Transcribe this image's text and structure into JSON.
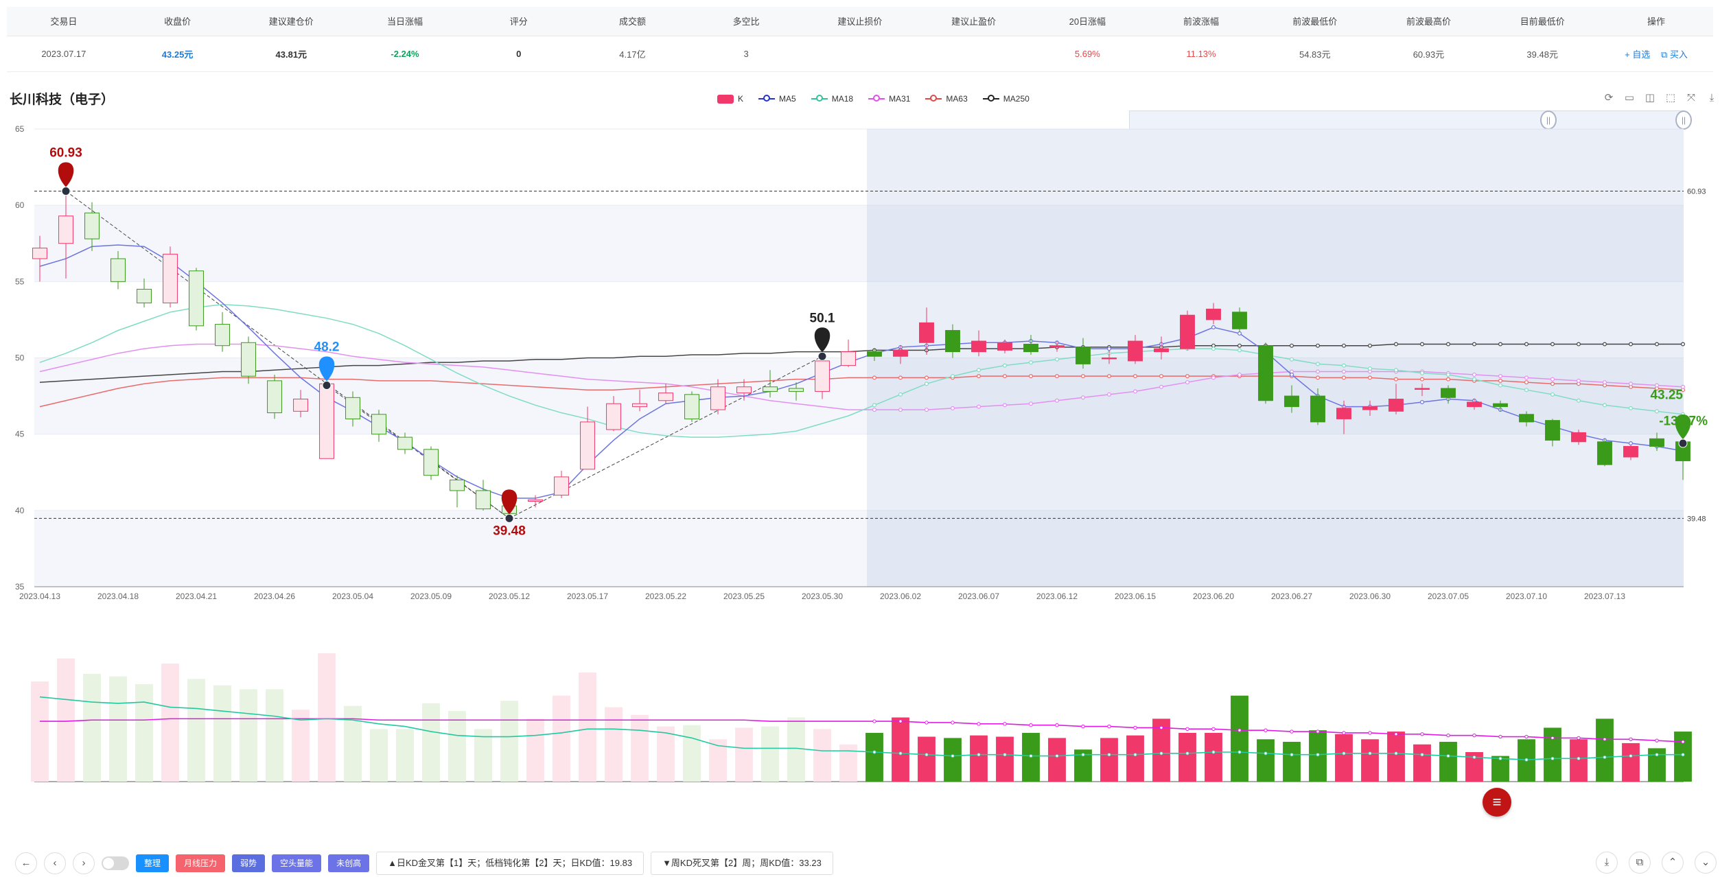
{
  "summary": {
    "headers": [
      "交易日",
      "收盘价",
      "建议建仓价",
      "当日涨幅",
      "评分",
      "成交额",
      "多空比",
      "建议止损价",
      "建议止盈价",
      "20日涨幅",
      "前波涨幅",
      "前波最低价",
      "前波最高价",
      "目前最低价",
      "操作"
    ],
    "row": {
      "date": "2023.07.17",
      "close": "43.25元",
      "build_price": "43.81元",
      "change": "-2.24%",
      "score": "0",
      "turnover": "4.17亿",
      "long_short": "3",
      "stop_loss": "",
      "take_profit": "",
      "change20": "5.69%",
      "prev_wave_change": "11.13%",
      "prev_wave_low": "54.83元",
      "prev_wave_high": "60.93元",
      "current_low": "39.48元",
      "op_watch": "+ 自选",
      "op_buy": "买入"
    }
  },
  "stock_title": "长川科技（电子）",
  "legend": [
    {
      "name": "K",
      "color": "#f0386a",
      "type": "k"
    },
    {
      "name": "MA5",
      "color": "#2233cc",
      "type": "line"
    },
    {
      "name": "MA18",
      "color": "#31c29a",
      "type": "line"
    },
    {
      "name": "MA31",
      "color": "#e34de8",
      "type": "line"
    },
    {
      "name": "MA63",
      "color": "#e04848",
      "type": "line"
    },
    {
      "name": "MA250",
      "color": "#222222",
      "type": "line"
    }
  ],
  "toolbox_icons": [
    "refresh-icon",
    "data-view-icon",
    "restore-icon",
    "brush-icon",
    "fullscreen-icon",
    "download-icon"
  ],
  "zoom": {
    "start_icon": "||",
    "end_icon": "||"
  },
  "colors": {
    "up": "#f0386a",
    "down": "#3a9a1a",
    "ma5": "#6b74e0",
    "ma18": "#7fdcc3",
    "ma31": "#e28ff0",
    "ma63": "#e86a6a",
    "ma250": "#444444",
    "vol_ma_green": "#20c9a0",
    "vol_ma_magenta": "#e11be5"
  },
  "chart_data": {
    "type": "candlestick",
    "title": "长川科技（电子）",
    "y_ticks": [
      35,
      40,
      45,
      50,
      55,
      60,
      65
    ],
    "ylim": [
      35,
      65
    ],
    "x_tick_labels": [
      "2023.04.13",
      "2023.04.18",
      "2023.04.21",
      "2023.04.26",
      "2023.05.04",
      "2023.05.09",
      "2023.05.12",
      "2023.05.17",
      "2023.05.22",
      "2023.05.25",
      "2023.05.30",
      "2023.06.02",
      "2023.06.07",
      "2023.06.12",
      "2023.06.15",
      "2023.06.20",
      "2023.06.27",
      "2023.06.30",
      "2023.07.05",
      "2023.07.10",
      "2023.07.13"
    ],
    "x_tick_index": [
      0,
      3,
      6,
      9,
      12,
      15,
      18,
      21,
      24,
      27,
      30,
      33,
      36,
      39,
      42,
      45,
      48,
      51,
      54,
      57,
      60
    ],
    "candles": [
      {
        "o": 56.5,
        "c": 57.2,
        "h": 58.0,
        "l": 55.0
      },
      {
        "o": 57.5,
        "c": 59.3,
        "h": 60.93,
        "l": 55.2
      },
      {
        "o": 59.5,
        "c": 57.8,
        "h": 60.2,
        "l": 57.0
      },
      {
        "o": 56.5,
        "c": 55.0,
        "h": 57.0,
        "l": 54.5
      },
      {
        "o": 54.5,
        "c": 53.6,
        "h": 55.2,
        "l": 53.3
      },
      {
        "o": 53.6,
        "c": 56.8,
        "h": 57.3,
        "l": 53.3
      },
      {
        "o": 55.7,
        "c": 52.1,
        "h": 55.9,
        "l": 51.8
      },
      {
        "o": 52.2,
        "c": 50.8,
        "h": 53.0,
        "l": 50.4
      },
      {
        "o": 51.0,
        "c": 48.8,
        "h": 51.4,
        "l": 48.3
      },
      {
        "o": 48.5,
        "c": 46.4,
        "h": 48.9,
        "l": 46.0
      },
      {
        "o": 46.5,
        "c": 47.3,
        "h": 47.9,
        "l": 46.1
      },
      {
        "o": 43.4,
        "c": 48.3,
        "h": 49.0,
        "l": 43.4
      },
      {
        "o": 47.4,
        "c": 46.0,
        "h": 47.8,
        "l": 45.5
      },
      {
        "o": 46.3,
        "c": 45.0,
        "h": 46.6,
        "l": 44.5
      },
      {
        "o": 44.8,
        "c": 44.0,
        "h": 45.1,
        "l": 43.7
      },
      {
        "o": 44.0,
        "c": 42.3,
        "h": 44.2,
        "l": 42.0
      },
      {
        "o": 42.0,
        "c": 41.3,
        "h": 42.3,
        "l": 40.2
      },
      {
        "o": 41.3,
        "c": 40.1,
        "h": 42.0,
        "l": 40.0
      },
      {
        "o": 40.3,
        "c": 39.8,
        "h": 40.6,
        "l": 39.48
      },
      {
        "o": 40.6,
        "c": 40.7,
        "h": 41.0,
        "l": 40.2
      },
      {
        "o": 41.0,
        "c": 42.2,
        "h": 42.6,
        "l": 40.8
      },
      {
        "o": 42.7,
        "c": 45.8,
        "h": 46.8,
        "l": 42.7
      },
      {
        "o": 45.3,
        "c": 47.0,
        "h": 47.5,
        "l": 45.2
      },
      {
        "o": 46.8,
        "c": 47.0,
        "h": 47.9,
        "l": 46.5
      },
      {
        "o": 47.2,
        "c": 47.7,
        "h": 48.3,
        "l": 47.0
      },
      {
        "o": 47.6,
        "c": 46.0,
        "h": 47.8,
        "l": 45.8
      },
      {
        "o": 46.6,
        "c": 48.1,
        "h": 48.6,
        "l": 46.3
      },
      {
        "o": 47.7,
        "c": 48.1,
        "h": 48.6,
        "l": 47.2
      },
      {
        "o": 48.1,
        "c": 47.8,
        "h": 49.2,
        "l": 47.4
      },
      {
        "o": 48.0,
        "c": 47.8,
        "h": 48.4,
        "l": 47.2
      },
      {
        "o": 47.8,
        "c": 49.8,
        "h": 50.4,
        "l": 47.3
      },
      {
        "o": 49.5,
        "c": 50.4,
        "h": 51.2,
        "l": 49.4
      },
      {
        "o": 50.4,
        "c": 50.1,
        "h": 50.6,
        "l": 49.8
      },
      {
        "o": 50.1,
        "c": 50.5,
        "h": 50.8,
        "l": 49.6
      },
      {
        "o": 51.0,
        "c": 52.3,
        "h": 53.3,
        "l": 50.2
      },
      {
        "o": 51.8,
        "c": 50.4,
        "h": 52.2,
        "l": 50.0
      },
      {
        "o": 50.4,
        "c": 51.1,
        "h": 51.8,
        "l": 50.1
      },
      {
        "o": 50.5,
        "c": 51.0,
        "h": 51.2,
        "l": 50.3
      },
      {
        "o": 50.9,
        "c": 50.4,
        "h": 51.5,
        "l": 50.2
      },
      {
        "o": 50.7,
        "c": 50.8,
        "h": 51.1,
        "l": 50.4
      },
      {
        "o": 50.7,
        "c": 49.6,
        "h": 51.3,
        "l": 49.3
      },
      {
        "o": 50.0,
        "c": 50.0,
        "h": 50.5,
        "l": 49.6
      },
      {
        "o": 49.8,
        "c": 51.1,
        "h": 51.5,
        "l": 49.6
      },
      {
        "o": 50.4,
        "c": 50.6,
        "h": 51.4,
        "l": 49.9
      },
      {
        "o": 50.6,
        "c": 52.8,
        "h": 53.1,
        "l": 50.5
      },
      {
        "o": 52.5,
        "c": 53.2,
        "h": 53.6,
        "l": 52.2
      },
      {
        "o": 53.0,
        "c": 51.9,
        "h": 53.3,
        "l": 51.7
      },
      {
        "o": 50.8,
        "c": 47.2,
        "h": 51.0,
        "l": 47.0
      },
      {
        "o": 47.5,
        "c": 46.8,
        "h": 48.2,
        "l": 46.4
      },
      {
        "o": 47.5,
        "c": 45.8,
        "h": 48.0,
        "l": 45.6
      },
      {
        "o": 46.0,
        "c": 46.7,
        "h": 47.2,
        "l": 45.0
      },
      {
        "o": 46.6,
        "c": 46.8,
        "h": 47.2,
        "l": 46.2
      },
      {
        "o": 46.5,
        "c": 47.3,
        "h": 48.3,
        "l": 46.3
      },
      {
        "o": 48.0,
        "c": 48.0,
        "h": 48.3,
        "l": 47.5
      },
      {
        "o": 48.0,
        "c": 47.4,
        "h": 48.2,
        "l": 47.0
      },
      {
        "o": 46.8,
        "c": 47.1,
        "h": 47.3,
        "l": 46.6
      },
      {
        "o": 47.0,
        "c": 46.8,
        "h": 47.2,
        "l": 46.5
      },
      {
        "o": 46.3,
        "c": 45.8,
        "h": 46.5,
        "l": 45.5
      },
      {
        "o": 45.9,
        "c": 44.6,
        "h": 46.0,
        "l": 44.2
      },
      {
        "o": 44.5,
        "c": 45.1,
        "h": 45.3,
        "l": 44.3
      },
      {
        "o": 44.5,
        "c": 43.0,
        "h": 44.7,
        "l": 42.9
      },
      {
        "o": 43.5,
        "c": 44.2,
        "h": 44.3,
        "l": 43.3
      },
      {
        "o": 44.7,
        "c": 44.2,
        "h": 45.1,
        "l": 43.9
      },
      {
        "o": 44.5,
        "c": 43.25,
        "h": 45.0,
        "l": 42.0
      }
    ],
    "ma5": [
      56.0,
      56.5,
      57.3,
      57.4,
      57.3,
      56.3,
      55.0,
      53.6,
      52.0,
      50.3,
      48.7,
      47.4,
      46.5,
      45.5,
      44.5,
      43.3,
      42.2,
      41.4,
      40.8,
      40.8,
      41.2,
      43.0,
      44.6,
      46.0,
      47.0,
      47.2,
      47.4,
      47.5,
      47.8,
      48.3,
      49.0,
      49.7,
      50.3,
      50.7,
      50.8,
      50.9,
      51.0,
      51.0,
      51.1,
      51.0,
      50.6,
      50.6,
      50.6,
      50.9,
      51.3,
      52.0,
      51.6,
      50.4,
      48.9,
      47.5,
      46.8,
      46.8,
      46.9,
      47.1,
      47.3,
      47.2,
      46.6,
      46.0,
      45.5,
      45.0,
      44.6,
      44.4,
      44.2,
      43.9
    ],
    "ma18": [
      49.7,
      50.3,
      51.0,
      51.8,
      52.4,
      53.0,
      53.3,
      53.5,
      53.4,
      53.2,
      52.9,
      52.6,
      52.2,
      51.6,
      50.8,
      49.9,
      49.0,
      48.2,
      47.5,
      46.9,
      46.4,
      46.0,
      45.5,
      45.1,
      44.9,
      44.8,
      44.8,
      44.9,
      45.0,
      45.2,
      45.7,
      46.2,
      46.9,
      47.6,
      48.3,
      48.8,
      49.2,
      49.5,
      49.7,
      49.9,
      50.1,
      50.3,
      50.4,
      50.5,
      50.6,
      50.6,
      50.5,
      50.2,
      49.9,
      49.6,
      49.5,
      49.3,
      49.2,
      49.0,
      48.9,
      48.6,
      48.2,
      47.9,
      47.6,
      47.2,
      46.9,
      46.7,
      46.5,
      46.3
    ],
    "ma31": [
      49.1,
      49.5,
      49.9,
      50.3,
      50.6,
      50.8,
      50.9,
      50.9,
      50.9,
      50.8,
      50.6,
      50.4,
      50.1,
      49.9,
      49.7,
      49.6,
      49.5,
      49.4,
      49.2,
      49.0,
      48.8,
      48.6,
      48.5,
      48.4,
      48.3,
      48.1,
      47.8,
      47.5,
      47.2,
      47.0,
      46.8,
      46.6,
      46.6,
      46.6,
      46.6,
      46.7,
      46.8,
      46.9,
      47.0,
      47.2,
      47.4,
      47.6,
      47.8,
      48.1,
      48.4,
      48.7,
      48.9,
      49.0,
      49.1,
      49.1,
      49.1,
      49.1,
      49.1,
      49.1,
      49.0,
      48.9,
      48.8,
      48.7,
      48.6,
      48.5,
      48.4,
      48.3,
      48.2,
      48.1
    ],
    "ma63": [
      46.8,
      47.2,
      47.6,
      48.0,
      48.3,
      48.5,
      48.6,
      48.7,
      48.7,
      48.7,
      48.7,
      48.6,
      48.6,
      48.5,
      48.5,
      48.5,
      48.4,
      48.3,
      48.2,
      48.1,
      48.0,
      47.9,
      47.9,
      48.0,
      48.1,
      48.2,
      48.3,
      48.4,
      48.5,
      48.6,
      48.6,
      48.7,
      48.7,
      48.7,
      48.7,
      48.7,
      48.8,
      48.8,
      48.8,
      48.8,
      48.8,
      48.8,
      48.8,
      48.8,
      48.8,
      48.8,
      48.8,
      48.8,
      48.8,
      48.7,
      48.7,
      48.7,
      48.6,
      48.6,
      48.6,
      48.5,
      48.5,
      48.4,
      48.3,
      48.3,
      48.2,
      48.1,
      48.0,
      47.9
    ],
    "ma250": [
      48.4,
      48.5,
      48.6,
      48.7,
      48.8,
      48.9,
      49.0,
      49.1,
      49.1,
      49.2,
      49.3,
      49.4,
      49.5,
      49.5,
      49.6,
      49.7,
      49.7,
      49.8,
      49.8,
      49.9,
      49.9,
      50.0,
      50.0,
      50.1,
      50.1,
      50.2,
      50.2,
      50.3,
      50.3,
      50.4,
      50.4,
      50.4,
      50.5,
      50.5,
      50.5,
      50.6,
      50.6,
      50.6,
      50.6,
      50.7,
      50.7,
      50.7,
      50.7,
      50.7,
      50.8,
      50.8,
      50.8,
      50.8,
      50.8,
      50.8,
      50.8,
      50.8,
      50.9,
      50.9,
      50.9,
      50.9,
      50.9,
      50.9,
      50.9,
      50.9,
      50.9,
      50.9,
      50.9,
      50.9
    ],
    "volume": [
      0.78,
      0.96,
      0.84,
      0.82,
      0.76,
      0.92,
      0.8,
      0.75,
      0.72,
      0.72,
      0.56,
      1.0,
      0.59,
      0.41,
      0.41,
      0.61,
      0.55,
      0.41,
      0.63,
      0.49,
      0.67,
      0.85,
      0.58,
      0.52,
      0.43,
      0.44,
      0.33,
      0.42,
      0.43,
      0.5,
      0.41,
      0.29,
      0.38,
      0.5,
      0.35,
      0.34,
      0.36,
      0.35,
      0.38,
      0.34,
      0.25,
      0.34,
      0.36,
      0.49,
      0.38,
      0.38,
      0.67,
      0.33,
      0.31,
      0.4,
      0.37,
      0.33,
      0.39,
      0.29,
      0.31,
      0.23,
      0.2,
      0.33,
      0.42,
      0.33,
      0.49,
      0.3,
      0.26,
      0.39
    ],
    "volume_hollow_until": 32,
    "vol_ma_green": [
      0.66,
      0.64,
      0.62,
      0.61,
      0.62,
      0.58,
      0.57,
      0.55,
      0.53,
      0.51,
      0.48,
      0.49,
      0.48,
      0.45,
      0.43,
      0.39,
      0.36,
      0.35,
      0.35,
      0.36,
      0.38,
      0.41,
      0.41,
      0.4,
      0.38,
      0.34,
      0.28,
      0.26,
      0.26,
      0.26,
      0.24,
      0.24,
      0.23,
      0.22,
      0.21,
      0.2,
      0.21,
      0.21,
      0.2,
      0.2,
      0.21,
      0.21,
      0.21,
      0.22,
      0.22,
      0.23,
      0.23,
      0.22,
      0.21,
      0.21,
      0.22,
      0.22,
      0.22,
      0.21,
      0.2,
      0.19,
      0.18,
      0.17,
      0.18,
      0.18,
      0.19,
      0.2,
      0.21,
      0.21
    ],
    "vol_ma_magenta": [
      0.47,
      0.47,
      0.48,
      0.48,
      0.48,
      0.49,
      0.49,
      0.49,
      0.49,
      0.49,
      0.49,
      0.49,
      0.49,
      0.48,
      0.48,
      0.48,
      0.48,
      0.48,
      0.48,
      0.48,
      0.48,
      0.48,
      0.48,
      0.48,
      0.48,
      0.48,
      0.48,
      0.48,
      0.47,
      0.47,
      0.47,
      0.47,
      0.47,
      0.47,
      0.46,
      0.46,
      0.45,
      0.45,
      0.44,
      0.44,
      0.43,
      0.43,
      0.42,
      0.42,
      0.41,
      0.41,
      0.4,
      0.4,
      0.39,
      0.39,
      0.38,
      0.38,
      0.37,
      0.37,
      0.36,
      0.36,
      0.35,
      0.35,
      0.34,
      0.34,
      0.33,
      0.33,
      0.32,
      0.31
    ],
    "trend_lines": [
      {
        "from": [
          1,
          60.93
        ],
        "to": [
          18,
          39.48
        ]
      },
      {
        "from": [
          11,
          48.2
        ],
        "to": [
          18,
          39.48
        ]
      },
      {
        "from": [
          18,
          39.48
        ],
        "to": [
          30,
          50.1
        ]
      }
    ],
    "h_lines": [
      {
        "value": 60.93,
        "label": "60.93"
      },
      {
        "value": 39.48,
        "label": "39.48"
      }
    ],
    "markers": [
      {
        "index": 1,
        "value": 60.93,
        "label": "60.93",
        "color": "#b30c0c",
        "label_pos": "above"
      },
      {
        "index": 11,
        "value": 48.2,
        "label": "48.2",
        "color": "#1e90ff",
        "label_pos": "above"
      },
      {
        "index": 18,
        "value": 39.48,
        "label": "39.48",
        "color": "#b30c0c",
        "label_pos": "below"
      },
      {
        "index": 30,
        "value": 50.1,
        "label": "50.1",
        "color": "#222222",
        "label_pos": "above"
      },
      {
        "index": 63,
        "value": 44.4,
        "label": "",
        "color": "#3a9a1a",
        "label_pos": "none"
      }
    ],
    "last_price_label": "43.25",
    "last_change_label": "-13.67%",
    "highlight_from_index": 32
  },
  "float_menu_icon": "≡",
  "bottom": {
    "nav_icons": [
      "←",
      "‹",
      "›"
    ],
    "tags": [
      {
        "label": "整理",
        "style": "blue"
      },
      {
        "label": "月线压力",
        "style": "pink"
      },
      {
        "label": "弱势",
        "style": "indigo"
      },
      {
        "label": "空头量能",
        "style": "purple"
      },
      {
        "label": "未创高",
        "style": "purple"
      }
    ],
    "info1": "▲日KD金叉第【1】天；低档钝化第【2】天；日KD值：19.83",
    "info2": "▼周KD死叉第【2】周；周KD值：33.23",
    "right_icons": [
      "⤓",
      "⧉",
      "⌃",
      "⌄"
    ]
  }
}
